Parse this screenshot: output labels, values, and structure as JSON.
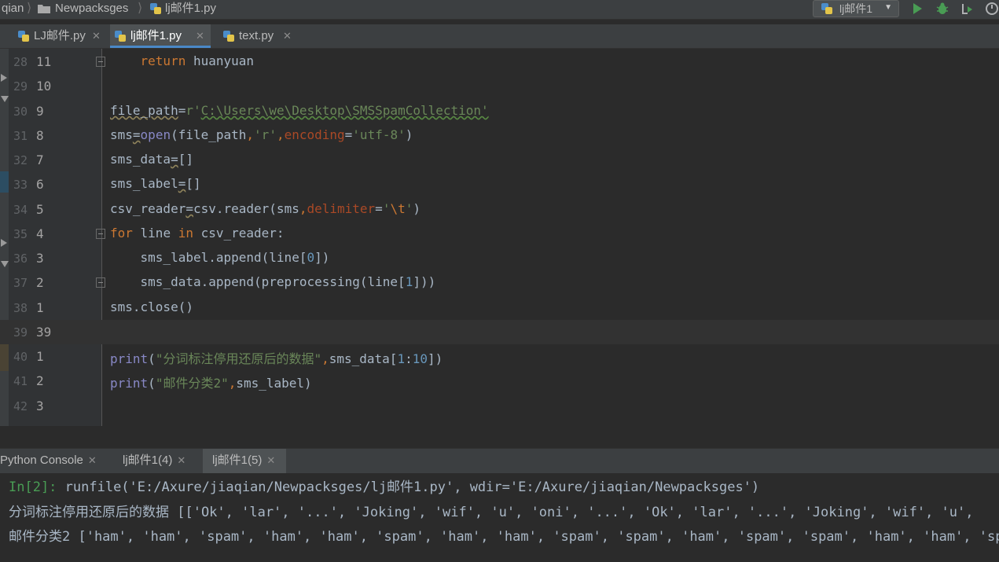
{
  "breadcrumb": {
    "project": "qian",
    "folder": "Newpacksges",
    "file": "lj邮件1.py"
  },
  "run_config": {
    "label": "lj邮件1"
  },
  "editor_tabs": [
    {
      "label": "LJ邮件.py",
      "active": false
    },
    {
      "label": "lj邮件1.py",
      "active": true
    },
    {
      "label": "text.py",
      "active": false
    }
  ],
  "code_lines": [
    {
      "abs": "28",
      "rel": "11",
      "text": "    return huanyuan"
    },
    {
      "abs": "29",
      "rel": "10",
      "text": ""
    },
    {
      "abs": "30",
      "rel": "9",
      "text": "file_path=r'C:\\Users\\we\\Desktop\\SMSSpamCollection'"
    },
    {
      "abs": "31",
      "rel": "8",
      "text": "sms=open(file_path,'r',encoding='utf-8')"
    },
    {
      "abs": "32",
      "rel": "7",
      "text": "sms_data=[]"
    },
    {
      "abs": "33",
      "rel": "6",
      "text": "sms_label=[]"
    },
    {
      "abs": "34",
      "rel": "5",
      "text": "csv_reader=csv.reader(sms,delimiter='\\t')"
    },
    {
      "abs": "35",
      "rel": "4",
      "text": "for line in csv_reader:"
    },
    {
      "abs": "36",
      "rel": "3",
      "text": "    sms_label.append(line[0])"
    },
    {
      "abs": "37",
      "rel": "2",
      "text": "    sms_data.append(preprocessing(line[1]))"
    },
    {
      "abs": "38",
      "rel": "1",
      "text": "sms.close()"
    },
    {
      "abs": "39",
      "rel": "39",
      "text": ""
    },
    {
      "abs": "40",
      "rel": "1",
      "text": "print(\"分词标注停用还原后的数据\",sms_data[1:10])"
    },
    {
      "abs": "41",
      "rel": "2",
      "text": "print(\"邮件分类2\",sms_label)"
    },
    {
      "abs": "42",
      "rel": "3",
      "text": ""
    }
  ],
  "console_tabs": [
    {
      "label": "Python Console"
    },
    {
      "label": "lj邮件1(4)"
    },
    {
      "label": "lj邮件1(5)"
    }
  ],
  "console": {
    "prompt": "In[2]:",
    "command": " runfile('E:/Axure/jiaqian/Newpacksges/lj邮件1.py', wdir='E:/Axure/jiaqian/Newpacksges')",
    "output1": "分词标注停用还原后的数据 [['Ok', 'lar', '...', 'Joking', 'wif', 'u', 'oni', '...', 'Ok', 'lar', '...', 'Joking', 'wif', 'u',",
    "output2": "邮件分类2 ['ham', 'ham', 'spam', 'ham', 'ham', 'spam', 'ham', 'ham', 'spam', 'spam', 'ham', 'spam', 'spam', 'ham', 'ham', 'sp"
  },
  "colors": {
    "keyword": "#cc7832",
    "string": "#6a8759",
    "number": "#6897bb",
    "builtin": "#8888c6",
    "accent": "#4a88c7"
  }
}
